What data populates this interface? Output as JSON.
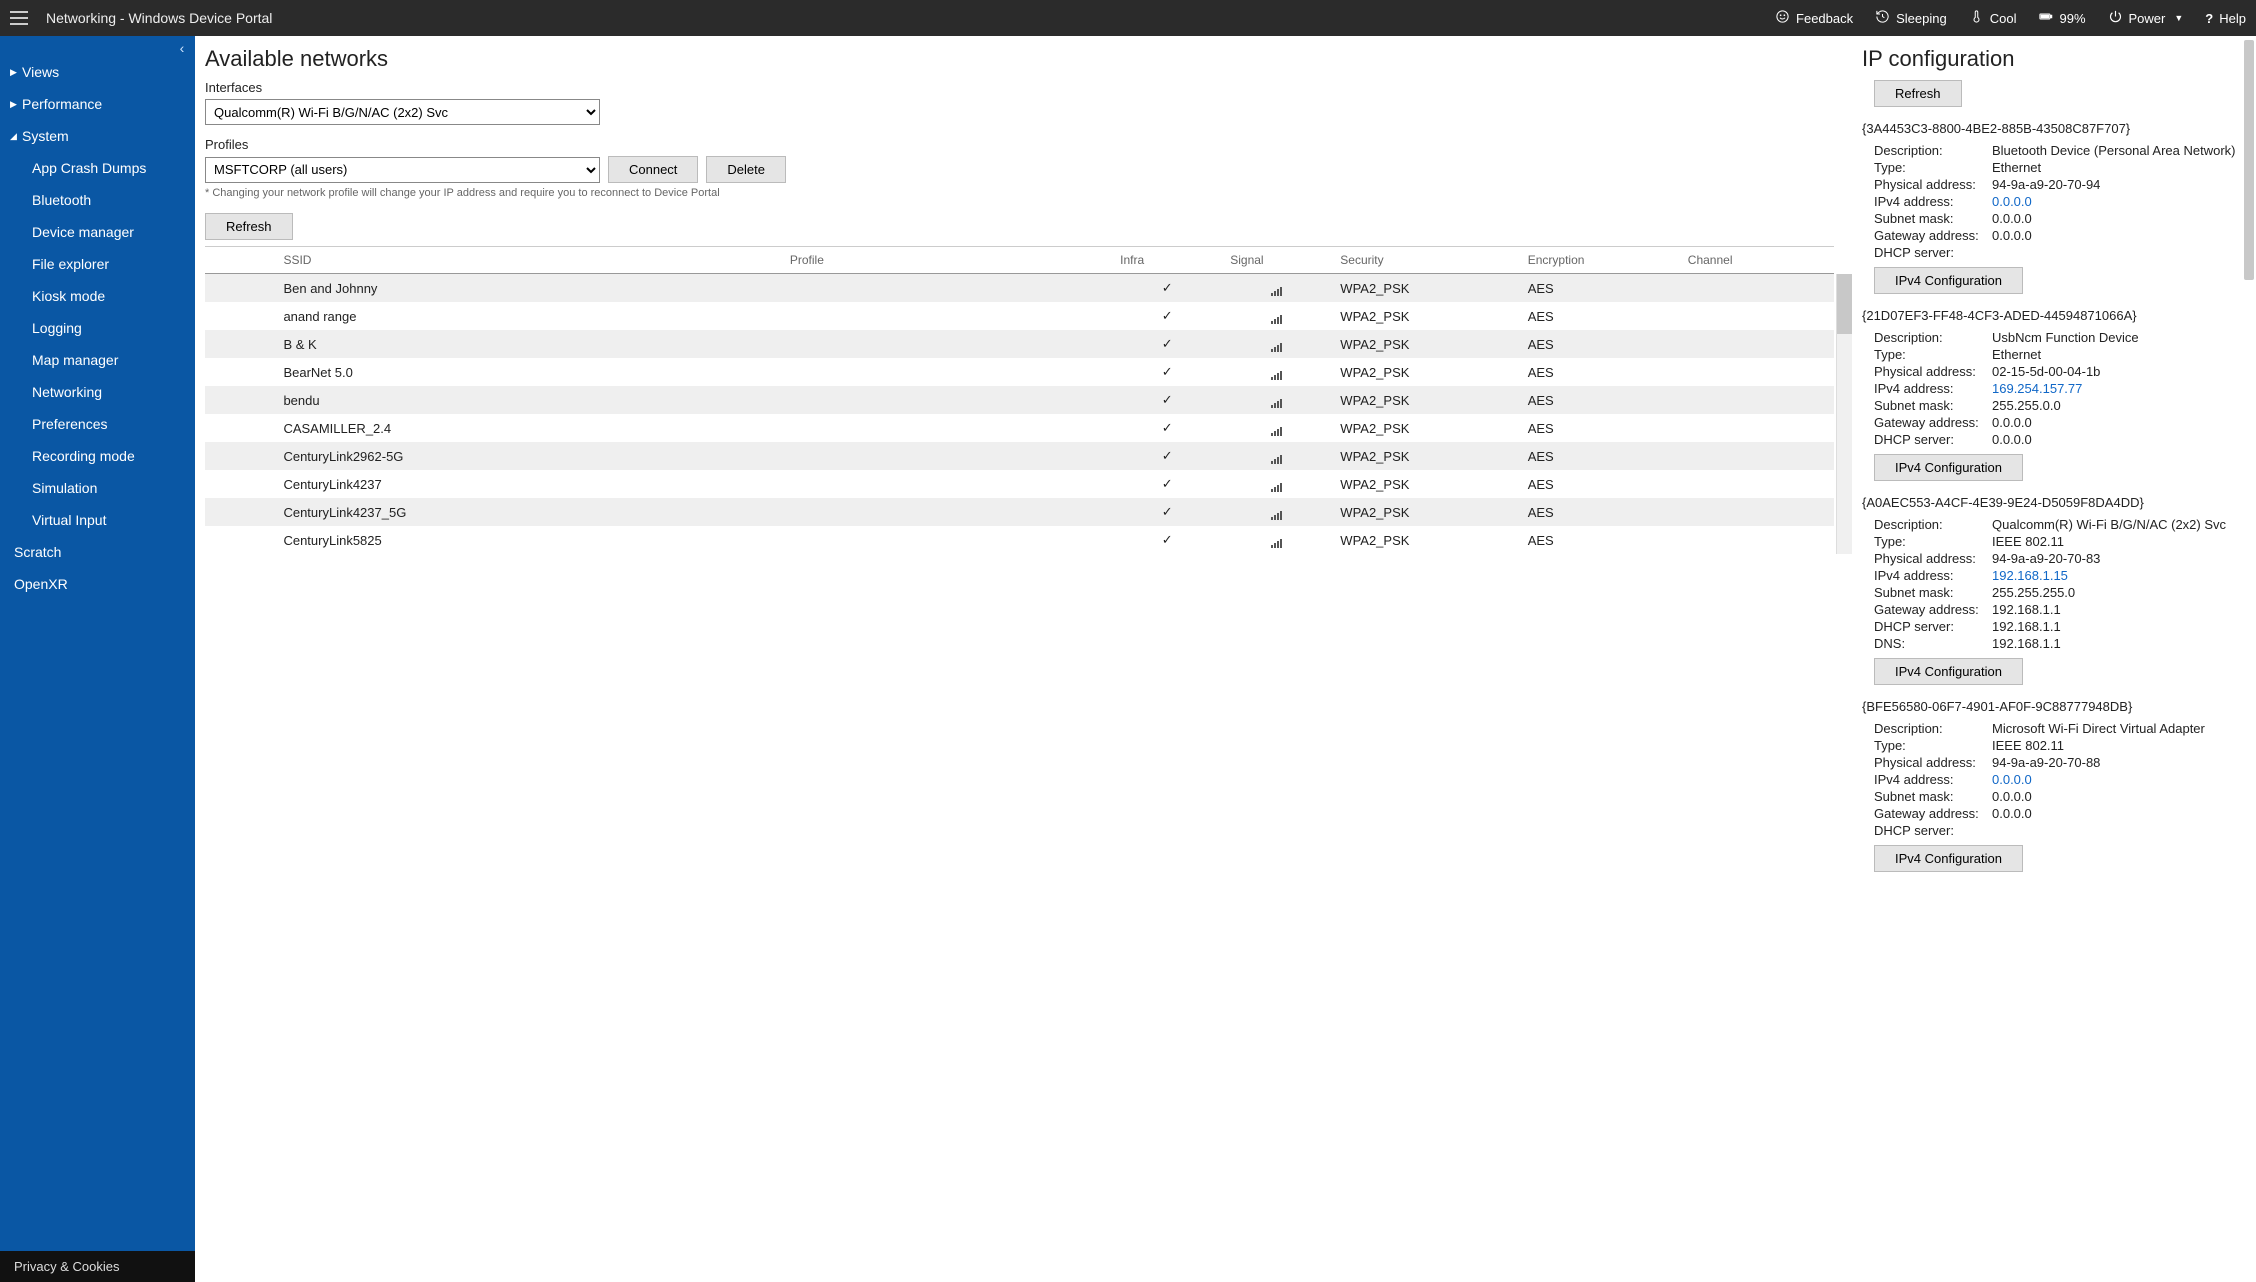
{
  "topbar": {
    "title": "Networking - Windows Device Portal",
    "feedback": "Feedback",
    "sleeping": "Sleeping",
    "cool": "Cool",
    "battery": "99%",
    "power": "Power",
    "help": "Help"
  },
  "sidebar": {
    "sections": [
      {
        "label": "Views",
        "expanded": false
      },
      {
        "label": "Performance",
        "expanded": false
      },
      {
        "label": "System",
        "expanded": true,
        "items": [
          "App Crash Dumps",
          "Bluetooth",
          "Device manager",
          "File explorer",
          "Kiosk mode",
          "Logging",
          "Map manager",
          "Networking",
          "Preferences",
          "Recording mode",
          "Simulation",
          "Virtual Input"
        ]
      },
      {
        "label": "Scratch",
        "expanded": false,
        "flat": true
      },
      {
        "label": "OpenXR",
        "expanded": false,
        "flat": true
      }
    ],
    "footer": "Privacy & Cookies"
  },
  "center": {
    "title": "Available networks",
    "interfaces_label": "Interfaces",
    "interface_selected": "Qualcomm(R) Wi-Fi B/G/N/AC (2x2) Svc",
    "profiles_label": "Profiles",
    "profile_selected": "MSFTCORP (all users)",
    "connect": "Connect",
    "delete": "Delete",
    "profile_hint": "* Changing your network profile will change your IP address and require you to reconnect to Device Portal",
    "refresh": "Refresh",
    "columns": [
      "",
      "SSID",
      "Profile",
      "Infra",
      "Signal",
      "Security",
      "Encryption",
      "Channel"
    ],
    "rows": [
      {
        "ssid": "Ben and Johnny",
        "profile": "",
        "infra": true,
        "security": "WPA2_PSK",
        "encryption": "AES"
      },
      {
        "ssid": "anand range",
        "profile": "",
        "infra": true,
        "security": "WPA2_PSK",
        "encryption": "AES"
      },
      {
        "ssid": "B & K",
        "profile": "",
        "infra": true,
        "security": "WPA2_PSK",
        "encryption": "AES"
      },
      {
        "ssid": "BearNet 5.0",
        "profile": "",
        "infra": true,
        "security": "WPA2_PSK",
        "encryption": "AES"
      },
      {
        "ssid": "bendu",
        "profile": "",
        "infra": true,
        "security": "WPA2_PSK",
        "encryption": "AES"
      },
      {
        "ssid": "CASAMILLER_2.4",
        "profile": "",
        "infra": true,
        "security": "WPA2_PSK",
        "encryption": "AES"
      },
      {
        "ssid": "CenturyLink2962-5G",
        "profile": "",
        "infra": true,
        "security": "WPA2_PSK",
        "encryption": "AES"
      },
      {
        "ssid": "CenturyLink4237",
        "profile": "",
        "infra": true,
        "security": "WPA2_PSK",
        "encryption": "AES"
      },
      {
        "ssid": "CenturyLink4237_5G",
        "profile": "",
        "infra": true,
        "security": "WPA2_PSK",
        "encryption": "AES"
      },
      {
        "ssid": "CenturyLink5825",
        "profile": "",
        "infra": true,
        "security": "WPA2_PSK",
        "encryption": "AES"
      }
    ]
  },
  "right": {
    "title": "IP configuration",
    "refresh": "Refresh",
    "ipv4btn": "IPv4 Configuration",
    "labels": {
      "description": "Description:",
      "type": "Type:",
      "phys": "Physical address:",
      "ipv4": "IPv4 address:",
      "subnet": "Subnet mask:",
      "gateway": "Gateway address:",
      "dhcp": "DHCP server:",
      "dns": "DNS:"
    },
    "adapters": [
      {
        "guid": "{3A4453C3-8800-4BE2-885B-43508C87F707}",
        "description": "Bluetooth Device (Personal Area Network)",
        "type": "Ethernet",
        "phys": "94-9a-a9-20-70-94",
        "ipv4": "0.0.0.0",
        "subnet": "0.0.0.0",
        "gateway": "0.0.0.0",
        "dhcp": ""
      },
      {
        "guid": "{21D07EF3-FF48-4CF3-ADED-44594871066A}",
        "description": "UsbNcm Function Device",
        "type": "Ethernet",
        "phys": "02-15-5d-00-04-1b",
        "ipv4": "169.254.157.77",
        "subnet": "255.255.0.0",
        "gateway": "0.0.0.0",
        "dhcp": "0.0.0.0"
      },
      {
        "guid": "{A0AEC553-A4CF-4E39-9E24-D5059F8DA4DD}",
        "description": "Qualcomm(R) Wi-Fi B/G/N/AC (2x2) Svc",
        "type": "IEEE 802.11",
        "phys": "94-9a-a9-20-70-83",
        "ipv4": "192.168.1.15",
        "subnet": "255.255.255.0",
        "gateway": "192.168.1.1",
        "dhcp": "192.168.1.1",
        "dns": "192.168.1.1"
      },
      {
        "guid": "{BFE56580-06F7-4901-AF0F-9C88777948DB}",
        "description": "Microsoft Wi-Fi Direct Virtual Adapter",
        "type": "IEEE 802.11",
        "phys": "94-9a-a9-20-70-88",
        "ipv4": "0.0.0.0",
        "subnet": "0.0.0.0",
        "gateway": "0.0.0.0",
        "dhcp": ""
      }
    ]
  }
}
